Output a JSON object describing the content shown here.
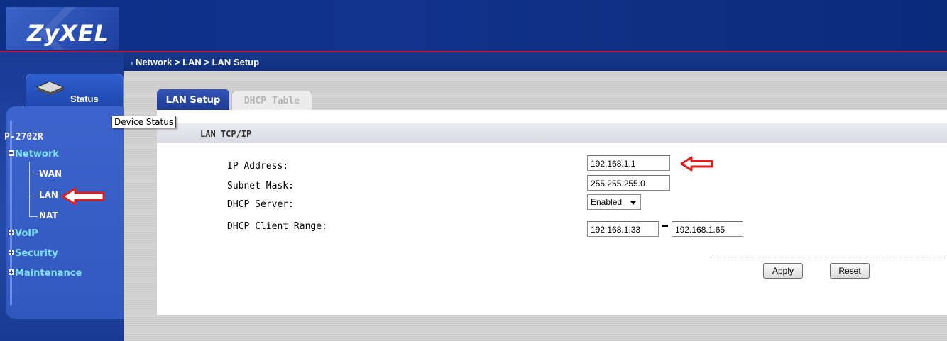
{
  "brand": {
    "logo": "ZyXEL"
  },
  "sidebar": {
    "status_label": "Status",
    "device_name": "P-2702R",
    "network": {
      "label": "Network",
      "items": [
        "WAN",
        "LAN",
        "NAT"
      ]
    },
    "voip": "VoIP",
    "security": "Security",
    "maintenance": "Maintenance",
    "active_item": "LAN"
  },
  "tooltip": "Device Status",
  "breadcrumb": "Network > LAN > LAN Setup",
  "tabs": [
    {
      "label": "LAN Setup",
      "active": true
    },
    {
      "label": "DHCP Table",
      "active": false
    }
  ],
  "section": {
    "title": "LAN TCP/IP",
    "fields": {
      "ip_address": {
        "label": "IP Address:",
        "value": "192.168.1.1"
      },
      "subnet_mask": {
        "label": "Subnet Mask:",
        "value": "255.255.255.0"
      },
      "dhcp_server": {
        "label": "DHCP Server:",
        "value": "Enabled"
      },
      "dhcp_range": {
        "label": "DHCP Client Range:",
        "start": "192.168.1.33",
        "end": "192.168.1.65"
      }
    }
  },
  "buttons": {
    "apply": "Apply",
    "reset": "Reset"
  },
  "colors": {
    "banner": "#0d2f86",
    "accent_red": "#c8102e",
    "nav_cyan": "#7fe0ff"
  },
  "icons": [
    "router-icon",
    "red-arrow-icon",
    "expand-plus-icon",
    "collapse-minus-icon"
  ]
}
